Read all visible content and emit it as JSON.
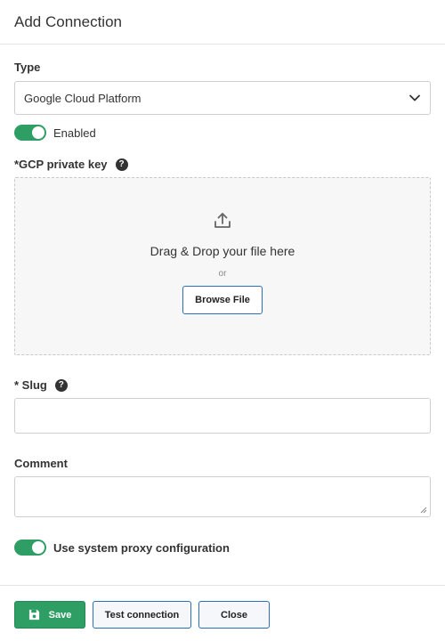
{
  "dialog": {
    "title": "Add Connection"
  },
  "type_field": {
    "label": "Type",
    "value": "Google Cloud Platform"
  },
  "enabled_toggle": {
    "label": "Enabled",
    "on": true
  },
  "private_key": {
    "label": "*GCP private key",
    "help": "?",
    "drop_text": "Drag & Drop your file here",
    "or_text": "or",
    "browse_label": "Browse File"
  },
  "slug": {
    "label": "* Slug",
    "help": "?",
    "value": ""
  },
  "comment": {
    "label": "Comment",
    "value": ""
  },
  "proxy_toggle": {
    "label": "Use system proxy configuration",
    "on": true
  },
  "footer": {
    "save_label": "Save",
    "test_label": "Test connection",
    "close_label": "Close"
  },
  "colors": {
    "accent_green": "#2e9e64",
    "outline_blue": "#2a6fb8"
  },
  "icons": [
    "chevron-down-icon",
    "help-icon",
    "upload-icon",
    "save-icon"
  ]
}
